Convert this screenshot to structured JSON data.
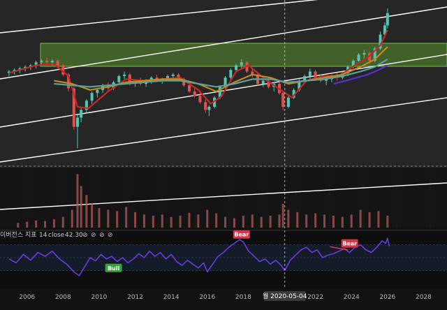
{
  "chart_data": {
    "type": "candlestick",
    "main": {
      "x_domain": [
        2004.5,
        2029.3
      ],
      "ylim": [
        0,
        100
      ],
      "y_scale": "log",
      "candles": [
        [
          2005.0,
          57,
          59,
          55,
          58
        ],
        [
          2005.3,
          58,
          60,
          56,
          59
        ],
        [
          2005.6,
          59,
          61,
          57,
          60
        ],
        [
          2005.9,
          60,
          62,
          58,
          61
        ],
        [
          2006.2,
          61,
          63,
          59,
          62
        ],
        [
          2006.5,
          62,
          65,
          60,
          64
        ],
        [
          2006.8,
          64,
          66,
          62,
          65
        ],
        [
          2007.1,
          65,
          67,
          63,
          64
        ],
        [
          2007.4,
          64,
          66,
          62,
          65
        ],
        [
          2007.7,
          65,
          66,
          60,
          62
        ],
        [
          2008.0,
          62,
          63,
          55,
          56
        ],
        [
          2008.3,
          56,
          57,
          45,
          47
        ],
        [
          2008.6,
          47,
          48,
          20,
          22
        ],
        [
          2008.8,
          22,
          30,
          8,
          28
        ],
        [
          2009.0,
          28,
          35,
          25,
          33
        ],
        [
          2009.3,
          33,
          40,
          31,
          39
        ],
        [
          2009.6,
          39,
          45,
          37,
          44
        ],
        [
          2009.9,
          44,
          47,
          41,
          46
        ],
        [
          2010.2,
          46,
          50,
          44,
          49
        ],
        [
          2010.5,
          49,
          51,
          45,
          47
        ],
        [
          2010.8,
          47,
          52,
          46,
          51
        ],
        [
          2011.1,
          51,
          56,
          50,
          55
        ],
        [
          2011.4,
          55,
          58,
          53,
          56
        ],
        [
          2011.7,
          56,
          57,
          49,
          50
        ],
        [
          2012.0,
          50,
          53,
          48,
          52
        ],
        [
          2012.3,
          52,
          54,
          49,
          50
        ],
        [
          2012.6,
          50,
          53,
          48,
          52
        ],
        [
          2012.9,
          52,
          55,
          50,
          54
        ],
        [
          2013.2,
          54,
          56,
          51,
          52
        ],
        [
          2013.5,
          52,
          54,
          50,
          53
        ],
        [
          2013.8,
          53,
          56,
          52,
          55
        ],
        [
          2014.1,
          55,
          57,
          53,
          56
        ],
        [
          2014.4,
          56,
          57,
          52,
          53
        ],
        [
          2014.7,
          53,
          54,
          48,
          49
        ],
        [
          2015.0,
          49,
          51,
          44,
          45
        ],
        [
          2015.3,
          45,
          47,
          41,
          42
        ],
        [
          2015.6,
          42,
          44,
          37,
          38
        ],
        [
          2015.9,
          38,
          40,
          31,
          33
        ],
        [
          2016.1,
          33,
          36,
          29,
          35
        ],
        [
          2016.4,
          35,
          42,
          34,
          41
        ],
        [
          2016.7,
          41,
          49,
          40,
          48
        ],
        [
          2017.0,
          48,
          55,
          47,
          54
        ],
        [
          2017.3,
          54,
          60,
          53,
          59
        ],
        [
          2017.6,
          59,
          63,
          57,
          62
        ],
        [
          2017.9,
          62,
          66,
          60,
          64
        ],
        [
          2018.2,
          64,
          65,
          57,
          58
        ],
        [
          2018.5,
          58,
          60,
          54,
          56
        ],
        [
          2018.8,
          56,
          57,
          49,
          50
        ],
        [
          2019.1,
          50,
          53,
          48,
          52
        ],
        [
          2019.4,
          52,
          54,
          47,
          48
        ],
        [
          2019.7,
          48,
          51,
          45,
          50
        ],
        [
          2020.0,
          50,
          52,
          43,
          44
        ],
        [
          2020.2,
          44,
          45,
          33,
          35
        ],
        [
          2020.5,
          35,
          42,
          34,
          41
        ],
        [
          2020.8,
          41,
          47,
          40,
          46
        ],
        [
          2021.1,
          46,
          53,
          45,
          52
        ],
        [
          2021.4,
          52,
          56,
          50,
          55
        ],
        [
          2021.7,
          55,
          60,
          53,
          58
        ],
        [
          2022.0,
          58,
          59,
          52,
          54
        ],
        [
          2022.3,
          54,
          56,
          51,
          52
        ],
        [
          2022.6,
          52,
          55,
          49,
          53
        ],
        [
          2022.9,
          53,
          56,
          51,
          55
        ],
        [
          2023.2,
          55,
          57,
          52,
          54
        ],
        [
          2023.5,
          54,
          58,
          53,
          57
        ],
        [
          2023.8,
          57,
          62,
          55,
          61
        ],
        [
          2024.1,
          61,
          66,
          60,
          65
        ],
        [
          2024.4,
          65,
          70,
          64,
          69
        ],
        [
          2024.7,
          69,
          72,
          66,
          70
        ],
        [
          2025.0,
          70,
          71,
          63,
          65
        ],
        [
          2025.3,
          65,
          74,
          64,
          73
        ],
        [
          2025.6,
          73,
          84,
          72,
          82
        ],
        [
          2025.85,
          82,
          90,
          80,
          88
        ],
        [
          2026.0,
          88,
          99,
          86,
          96
        ]
      ],
      "volume": [
        [
          2005.5,
          8
        ],
        [
          2006.0,
          10
        ],
        [
          2006.5,
          12
        ],
        [
          2007.0,
          11
        ],
        [
          2007.5,
          14
        ],
        [
          2008.0,
          18
        ],
        [
          2008.5,
          30
        ],
        [
          2008.8,
          90
        ],
        [
          2009.0,
          70
        ],
        [
          2009.3,
          55
        ],
        [
          2009.6,
          40
        ],
        [
          2010.0,
          33
        ],
        [
          2010.5,
          30
        ],
        [
          2011.0,
          28
        ],
        [
          2011.5,
          35
        ],
        [
          2012.0,
          26
        ],
        [
          2012.5,
          22
        ],
        [
          2013.0,
          20
        ],
        [
          2013.5,
          22
        ],
        [
          2014.0,
          18
        ],
        [
          2014.5,
          20
        ],
        [
          2015.0,
          25
        ],
        [
          2015.5,
          22
        ],
        [
          2016.0,
          30
        ],
        [
          2016.5,
          24
        ],
        [
          2017.0,
          18
        ],
        [
          2017.5,
          16
        ],
        [
          2018.0,
          20
        ],
        [
          2018.5,
          22
        ],
        [
          2019.0,
          18
        ],
        [
          2019.5,
          20
        ],
        [
          2020.0,
          22
        ],
        [
          2020.2,
          40
        ],
        [
          2020.5,
          30
        ],
        [
          2021.0,
          26
        ],
        [
          2021.5,
          22
        ],
        [
          2022.0,
          24
        ],
        [
          2022.5,
          22
        ],
        [
          2023.0,
          20
        ],
        [
          2023.5,
          18
        ],
        [
          2024.0,
          22
        ],
        [
          2024.5,
          30
        ],
        [
          2025.0,
          26
        ],
        [
          2025.5,
          28
        ],
        [
          2026.0,
          20
        ]
      ],
      "moving_averages": [
        {
          "color": "#c62828",
          "values": [
            [
              2005.0,
              57
            ],
            [
              2006.5,
              62
            ],
            [
              2007.5,
              63
            ],
            [
              2008.3,
              55
            ],
            [
              2008.8,
              35
            ],
            [
              2009.4,
              34
            ],
            [
              2010.5,
              45
            ],
            [
              2011.5,
              53
            ],
            [
              2012.5,
              52
            ],
            [
              2013.5,
              53
            ],
            [
              2014.5,
              54
            ],
            [
              2015.5,
              46
            ],
            [
              2016.2,
              37
            ],
            [
              2016.8,
              42
            ],
            [
              2017.6,
              58
            ],
            [
              2018.3,
              62
            ],
            [
              2019.2,
              53
            ],
            [
              2020.2,
              45
            ],
            [
              2020.7,
              41
            ],
            [
              2021.5,
              52
            ],
            [
              2022.4,
              55
            ],
            [
              2023.3,
              55
            ],
            [
              2024.3,
              63
            ],
            [
              2025.0,
              68
            ],
            [
              2025.6,
              75
            ],
            [
              2026.0,
              85
            ]
          ]
        },
        {
          "color": "#c48a1a",
          "values": [
            [
              2007.5,
              52
            ],
            [
              2008.5,
              50
            ],
            [
              2009.5,
              46
            ],
            [
              2010.5,
              48
            ],
            [
              2011.5,
              51
            ],
            [
              2012.5,
              52
            ],
            [
              2013.5,
              53
            ],
            [
              2014.5,
              53
            ],
            [
              2015.5,
              50
            ],
            [
              2016.5,
              45
            ],
            [
              2017.5,
              51
            ],
            [
              2018.5,
              56
            ],
            [
              2019.5,
              54
            ],
            [
              2020.5,
              50
            ],
            [
              2021.5,
              52
            ],
            [
              2022.5,
              54
            ],
            [
              2023.5,
              56
            ],
            [
              2024.5,
              61
            ],
            [
              2025.3,
              66
            ],
            [
              2026.0,
              74
            ]
          ]
        },
        {
          "color": "#5aa0a0",
          "values": [
            [
              2007.5,
              50
            ],
            [
              2008.5,
              49
            ],
            [
              2009.5,
              48
            ],
            [
              2010.5,
              49
            ],
            [
              2011.5,
              50
            ],
            [
              2012.5,
              51
            ],
            [
              2013.5,
              52
            ],
            [
              2014.5,
              52
            ],
            [
              2015.5,
              50
            ],
            [
              2016.5,
              48
            ],
            [
              2017.5,
              50
            ],
            [
              2018.5,
              53
            ],
            [
              2019.5,
              53
            ],
            [
              2020.5,
              51
            ],
            [
              2021.5,
              52
            ],
            [
              2022.5,
              53
            ],
            [
              2023.5,
              55
            ],
            [
              2024.5,
              58
            ],
            [
              2025.3,
              61
            ],
            [
              2026.0,
              66
            ]
          ]
        },
        {
          "color": "#5a2fd6",
          "values": [
            [
              2023.0,
              50
            ],
            [
              2023.7,
              52
            ],
            [
              2024.3,
              54
            ],
            [
              2024.9,
              56
            ],
            [
              2025.5,
              59
            ],
            [
              2026.0,
              62
            ]
          ]
        }
      ]
    },
    "indicator": {
      "label": "이버전스 지표",
      "length": "14",
      "source": "close",
      "last_value": "42.30",
      "ylim": [
        10,
        90
      ],
      "series": [
        [
          2005.0,
          48
        ],
        [
          2005.4,
          42
        ],
        [
          2005.8,
          55
        ],
        [
          2006.2,
          46
        ],
        [
          2006.6,
          58
        ],
        [
          2007.0,
          52
        ],
        [
          2007.4,
          60
        ],
        [
          2007.8,
          48
        ],
        [
          2008.2,
          40
        ],
        [
          2008.6,
          28
        ],
        [
          2008.9,
          22
        ],
        [
          2009.2,
          36
        ],
        [
          2009.5,
          50
        ],
        [
          2009.8,
          45
        ],
        [
          2010.1,
          55
        ],
        [
          2010.4,
          48
        ],
        [
          2010.7,
          52
        ],
        [
          2011.0,
          44
        ],
        [
          2011.3,
          50
        ],
        [
          2011.6,
          42
        ],
        [
          2011.9,
          48
        ],
        [
          2012.2,
          56
        ],
        [
          2012.5,
          50
        ],
        [
          2012.8,
          60
        ],
        [
          2013.1,
          52
        ],
        [
          2013.4,
          58
        ],
        [
          2013.7,
          48
        ],
        [
          2014.0,
          55
        ],
        [
          2014.3,
          44
        ],
        [
          2014.6,
          38
        ],
        [
          2014.9,
          46
        ],
        [
          2015.2,
          40
        ],
        [
          2015.5,
          34
        ],
        [
          2015.8,
          42
        ],
        [
          2016.0,
          28
        ],
        [
          2016.3,
          40
        ],
        [
          2016.6,
          52
        ],
        [
          2016.9,
          58
        ],
        [
          2017.2,
          66
        ],
        [
          2017.5,
          72
        ],
        [
          2017.8,
          78
        ],
        [
          2018.0,
          74
        ],
        [
          2018.3,
          60
        ],
        [
          2018.6,
          52
        ],
        [
          2018.9,
          44
        ],
        [
          2019.2,
          48
        ],
        [
          2019.5,
          40
        ],
        [
          2019.8,
          46
        ],
        [
          2020.1,
          38
        ],
        [
          2020.3,
          30
        ],
        [
          2020.6,
          46
        ],
        [
          2020.9,
          54
        ],
        [
          2021.2,
          62
        ],
        [
          2021.5,
          66
        ],
        [
          2021.8,
          58
        ],
        [
          2022.1,
          62
        ],
        [
          2022.4,
          50
        ],
        [
          2022.7,
          54
        ],
        [
          2023.0,
          56
        ],
        [
          2023.3,
          60
        ],
        [
          2023.6,
          64
        ],
        [
          2023.9,
          58
        ],
        [
          2024.2,
          66
        ],
        [
          2024.5,
          70
        ],
        [
          2024.8,
          62
        ],
        [
          2025.1,
          58
        ],
        [
          2025.4,
          66
        ],
        [
          2025.7,
          76
        ],
        [
          2025.9,
          72
        ],
        [
          2026.0,
          80
        ],
        [
          2026.1,
          68
        ]
      ],
      "divergence_lines": [
        {
          "color": "#e23a4e",
          "points": [
            [
              2022.8,
              67
            ],
            [
              2023.8,
              62
            ]
          ]
        }
      ],
      "labels": [
        {
          "text": "Bear",
          "color": "#d63447",
          "x": 2017.9,
          "y": 86
        },
        {
          "text": "Bull",
          "color": "#3aa13d",
          "x": 2010.8,
          "y": 34
        },
        {
          "text": "Bear",
          "color": "#d63447",
          "x": 2023.9,
          "y": 72
        }
      ]
    },
    "x_ticks": [
      "2006",
      "2008",
      "2010",
      "2012",
      "2014",
      "2016",
      "2018",
      "2020",
      "2022",
      "2024",
      "2026",
      "2028"
    ],
    "crosshair_label": "월 2020-05-04",
    "colors": {
      "up": "#52c7b4",
      "down": "#e0524d",
      "zone": "#5a8f2e",
      "channel": "#ffffff",
      "indicator": "#6a3be0"
    }
  }
}
